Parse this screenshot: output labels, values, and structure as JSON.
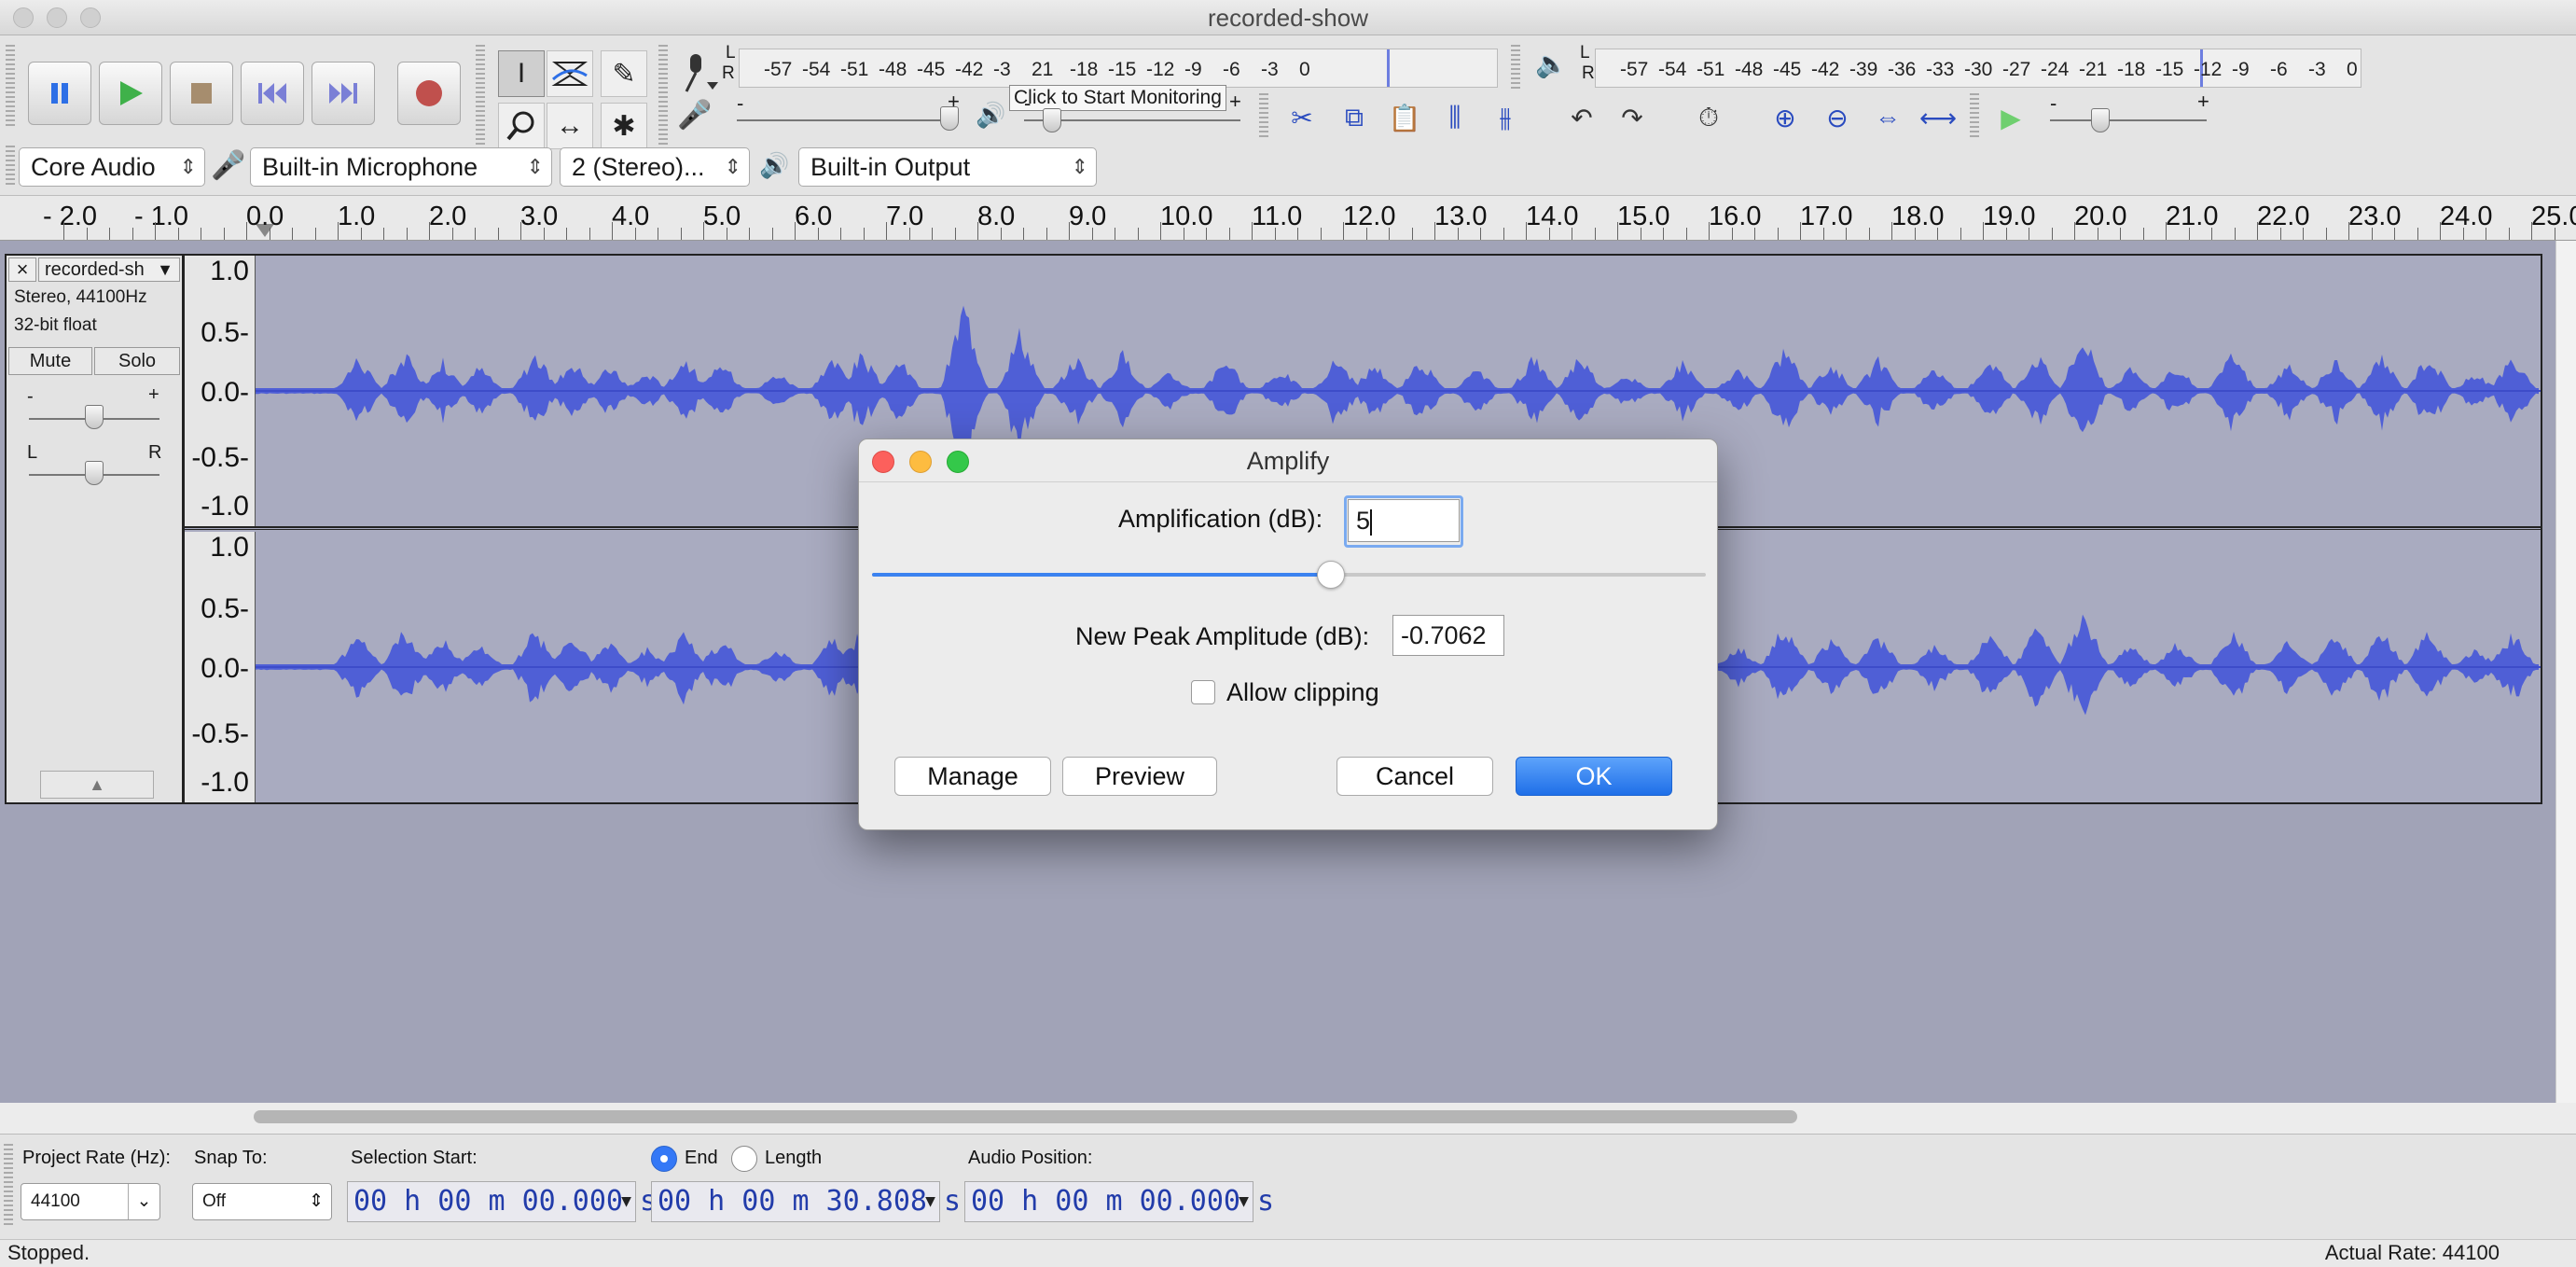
{
  "window": {
    "title": "recorded-show"
  },
  "meters": {
    "record_scale": [
      "-57",
      "-54",
      "-51",
      "-48",
      "-45",
      "-42",
      "-3",
      "21",
      "-18",
      "-15",
      "-12",
      "-9",
      "-6",
      "-3",
      "0"
    ],
    "record_tooltip": "Click to Start Monitoring",
    "play_scale": [
      "-57",
      "-54",
      "-51",
      "-48",
      "-45",
      "-42",
      "-39",
      "-36",
      "-33",
      "-30",
      "-27",
      "-24",
      "-21",
      "-18",
      "-15",
      "-12",
      "-9",
      "-6",
      "-3",
      "0"
    ],
    "channel_L": "L",
    "channel_R": "R",
    "minus": "-",
    "plus": "+"
  },
  "devices": {
    "host": "Core Audio",
    "input": "Built-in Microphone",
    "channels": "2 (Stereo)...",
    "output": "Built-in Output"
  },
  "ruler": [
    "- 2.0",
    "- 1.0",
    "0.0",
    "1.0",
    "2.0",
    "3.0",
    "4.0",
    "5.0",
    "6.0",
    "7.0",
    "8.0",
    "9.0",
    "10.0",
    "11.0",
    "12.0",
    "13.0",
    "14.0",
    "15.0",
    "16.0",
    "17.0",
    "18.0",
    "19.0",
    "20.0",
    "21.0",
    "22.0",
    "23.0",
    "24.0",
    "25.0"
  ],
  "track": {
    "name": "recorded-sh",
    "info_line1": "Stereo, 44100Hz",
    "info_line2": "32-bit float",
    "mute": "Mute",
    "solo": "Solo",
    "gain_minus": "-",
    "gain_plus": "+",
    "pan_L": "L",
    "pan_R": "R",
    "vscale": [
      "1.0",
      "0.5-",
      "0.0-",
      "-0.5-",
      "-1.0"
    ]
  },
  "dialog": {
    "title": "Amplify",
    "amp_label": "Amplification (dB):",
    "amp_value": "5",
    "slider_fraction": 0.55,
    "peak_label": "New Peak Amplitude (dB):",
    "peak_value": "-0.7062",
    "clip_label": "Allow clipping",
    "manage": "Manage",
    "preview": "Preview",
    "cancel": "Cancel",
    "ok": "OK"
  },
  "selection": {
    "rate_label": "Project Rate (Hz):",
    "rate_value": "44100",
    "snap_label": "Snap To:",
    "snap_value": "Off",
    "start_label": "Selection Start:",
    "start_value": "00 h 00 m 00.000 s",
    "end_label": "End",
    "length_label": "Length",
    "end_value": "00 h 00 m 30.808 s",
    "pos_label": "Audio Position:",
    "pos_value": "00 h 00 m 00.000 s"
  },
  "status": {
    "left": "Stopped.",
    "right": "Actual Rate: 44100"
  },
  "colors": {
    "waveform": "#4f5fd6",
    "ok_button": "#1f6fe8",
    "track_bg": "#a9abc0"
  }
}
